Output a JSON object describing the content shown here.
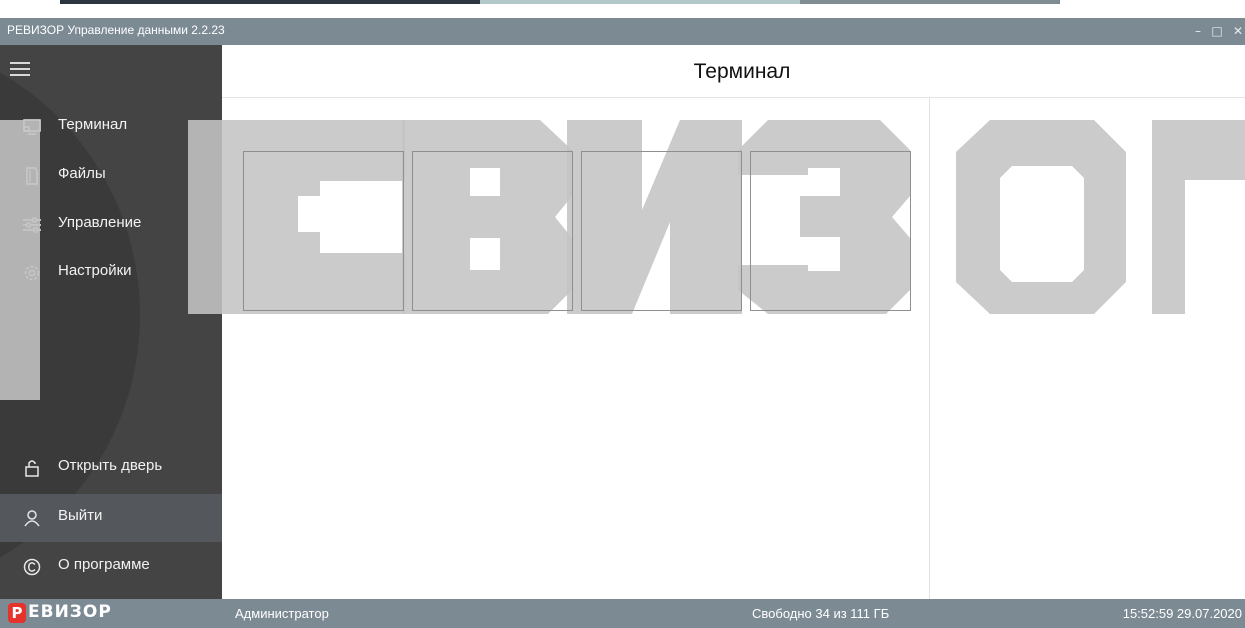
{
  "window": {
    "title": "РЕВИЗОР Управление данными 2.2.23",
    "minimize_glyph": "–",
    "maximize_glyph": "□",
    "close_glyph": "✕"
  },
  "sidebar": {
    "menu_icon": "hamburger-icon",
    "top_items": [
      {
        "label": "Терминал",
        "icon": "terminal-icon"
      },
      {
        "label": "Файлы",
        "icon": "files-icon"
      },
      {
        "label": "Управление",
        "icon": "sliders-icon"
      },
      {
        "label": "Настройки",
        "icon": "gear-icon"
      }
    ],
    "bottom_items": [
      {
        "label": "Открыть дверь",
        "icon": "lock-open-icon"
      },
      {
        "label": "Выйти",
        "icon": "user-icon",
        "active": true
      },
      {
        "label": "О программе",
        "icon": "copyright-icon"
      }
    ]
  },
  "header": {
    "title": "Терминал"
  },
  "watermark": {
    "text": "РЕВИЗОР"
  },
  "statusbar": {
    "brand_p": "Р",
    "brand_rest": "ЕВИЗОР",
    "user": "Администратор",
    "free_space": "Свободно 34 из 111 ГБ",
    "datetime": "15:52:59 29.07.2020"
  },
  "colors": {
    "titlebar": "#7c8a94",
    "sidebar": "#444444",
    "active_item": "#54585c",
    "brand_red": "#e5322d",
    "watermark": "#c4c4c4"
  }
}
